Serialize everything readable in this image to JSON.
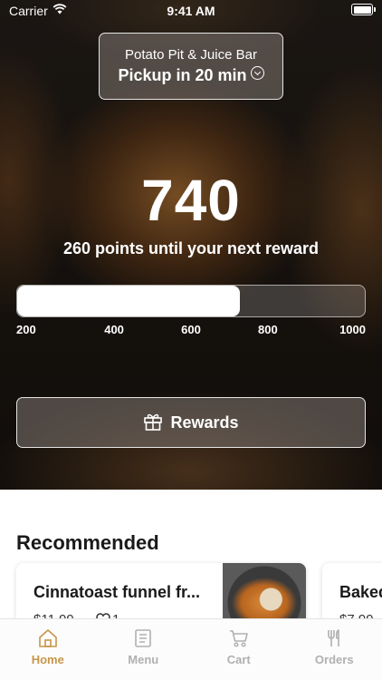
{
  "status_bar": {
    "carrier": "Carrier",
    "time": "9:41 AM"
  },
  "store": {
    "name": "Potato Pit & Juice Bar",
    "pickup": "Pickup in 20 min"
  },
  "points": {
    "value": "740",
    "until_text": "260 points until your next reward",
    "progress_fraction": 0.64,
    "ticks": [
      "200",
      "400",
      "600",
      "800",
      "1000"
    ]
  },
  "rewards_button": {
    "label": "Rewards",
    "icon": "gift-icon"
  },
  "recommended": {
    "title": "Recommended",
    "items": [
      {
        "name": "Cinnatoast funnel fr...",
        "price": "$11.99",
        "likes": "1"
      },
      {
        "name": "Baked",
        "price": "$7.99"
      }
    ]
  },
  "tabs": [
    {
      "label": "Home",
      "icon": "home-icon",
      "active": true
    },
    {
      "label": "Menu",
      "icon": "menu-icon",
      "active": false
    },
    {
      "label": "Cart",
      "icon": "cart-icon",
      "active": false
    },
    {
      "label": "Orders",
      "icon": "fork-knife-icon",
      "active": false
    }
  ],
  "colors": {
    "accent": "#c8954a",
    "inactive_tab": "#b0b0b0"
  }
}
